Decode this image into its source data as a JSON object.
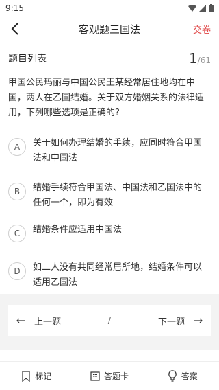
{
  "status_bar": {
    "time": "9:15"
  },
  "header": {
    "back_icon": "chevron-left-icon",
    "title": "客观题三国法",
    "submit_label": "交卷"
  },
  "question_list": {
    "label": "题目列表",
    "current": "1",
    "separator": "/",
    "total": "61"
  },
  "question": {
    "text": "甲国公民玛丽与中国公民王某经常居住地均在中国，两人在乙国结婚。关于双方婚姻关系的法律适用，下列哪些选项是正确的?"
  },
  "options": [
    {
      "letter": "A",
      "text": "关于如何办理结婚的手续，应同时符合甲国法和中国法"
    },
    {
      "letter": "B",
      "text": "结婚手续符合甲国法、中国法和乙国法中的任何一个，即为有效"
    },
    {
      "letter": "C",
      "text": "结婚条件应适用中国法"
    },
    {
      "letter": "D",
      "text": "如二人没有共同经常居所地，结婚条件可以适用乙国法"
    }
  ],
  "navigation": {
    "prev_label": "上一题",
    "separator": "/",
    "next_label": "下一题"
  },
  "tab_bar": [
    {
      "label": "标记",
      "icon": "bookmark-icon"
    },
    {
      "label": "答题卡",
      "icon": "answer-card-icon"
    },
    {
      "label": "答案",
      "icon": "lightbulb-icon"
    }
  ],
  "colors": {
    "accent": "#e04545",
    "nav_background": "#f3f3f3"
  }
}
